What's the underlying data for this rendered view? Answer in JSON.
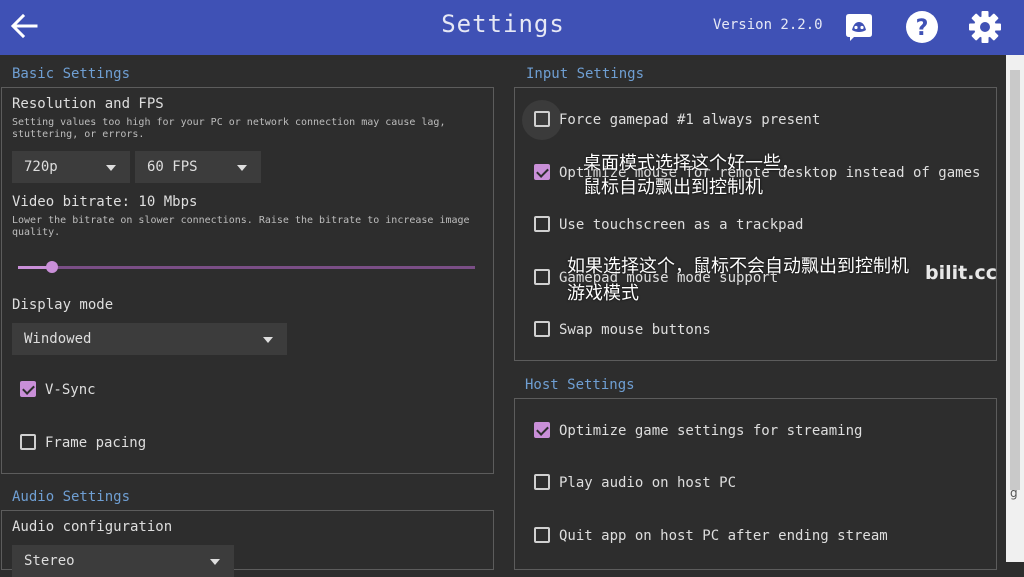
{
  "header": {
    "title": "Settings",
    "version": "Version 2.2.0",
    "icons": [
      "back-arrow-icon",
      "discord-icon",
      "help-icon",
      "gear-icon"
    ],
    "color": "#3f51b5"
  },
  "basic": {
    "title": "Basic Settings",
    "resolution_label": "Resolution and FPS",
    "resolution_hint_1": "Setting values too high for your PC or network connection may cause lag,",
    "resolution_hint_2": "stuttering, or errors.",
    "resolution_value": "720p",
    "fps_value": "60 FPS",
    "bitrate_label": "Video bitrate: 10 Mbps",
    "bitrate_hint_1": "Lower the bitrate on slower connections. Raise the bitrate to increase image",
    "bitrate_hint_2": "quality.",
    "bitrate_level": 0.074,
    "display_mode_label": "Display mode",
    "display_mode_value": "Windowed",
    "vsync_label": "V-Sync",
    "vsync_checked": true,
    "frame_pacing_label": "Frame pacing",
    "frame_pacing_checked": false
  },
  "audio": {
    "title": "Audio Settings",
    "config_label": "Audio configuration",
    "config_value": "Stereo"
  },
  "input": {
    "title": "Input Settings",
    "items": [
      {
        "label": "Force gamepad #1 always present",
        "checked": false
      },
      {
        "label": "Optimize mouse for remote desktop instead of games",
        "checked": true
      },
      {
        "label": "Use touchscreen as a trackpad",
        "checked": false
      },
      {
        "label": "Gamepad mouse mode support",
        "checked": false
      },
      {
        "label": "Swap mouse buttons",
        "checked": false
      }
    ]
  },
  "host": {
    "title": "Host Settings",
    "items": [
      {
        "label": "Optimize game settings for streaming",
        "checked": true
      },
      {
        "label": "Play audio on host PC",
        "checked": false
      },
      {
        "label": "Quit app on host PC after ending stream",
        "checked": false
      }
    ]
  },
  "overlay": {
    "note1_line1": "桌面模式选择这个好一些，",
    "note1_line2": "鼠标自动飘出到控制机",
    "note2_line1": "如果选择这个，鼠标不会自动飘出到控制机",
    "note2_line2": "游戏模式",
    "watermark": "bilit.cc"
  },
  "scrollbar": {
    "marker": "g"
  },
  "colors": {
    "accent": "#c98fd8",
    "section_title": "#6f9fd3",
    "background": "#2d2d2d"
  }
}
